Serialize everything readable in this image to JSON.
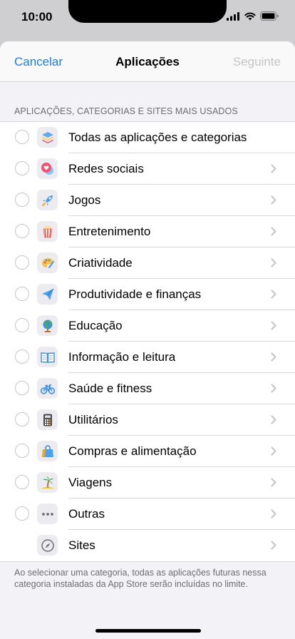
{
  "status_bar": {
    "time": "10:00"
  },
  "nav": {
    "cancel_label": "Cancelar",
    "title": "Aplicações",
    "next_label": "Seguinte"
  },
  "section_header": "APLICAÇÕES, CATEGORIAS E SITES MAIS USADOS",
  "categories": [
    {
      "label": "Todas as aplicações e categorias",
      "icon": "stack-icon"
    },
    {
      "label": "Redes sociais",
      "icon": "speech-bubble-heart-icon"
    },
    {
      "label": "Jogos",
      "icon": "rocket-icon"
    },
    {
      "label": "Entretenimento",
      "icon": "popcorn-icon"
    },
    {
      "label": "Criatividade",
      "icon": "palette-icon"
    },
    {
      "label": "Produtividade e finanças",
      "icon": "paper-plane-icon"
    },
    {
      "label": "Educação",
      "icon": "globe-icon"
    },
    {
      "label": "Informação e leitura",
      "icon": "book-icon"
    },
    {
      "label": "Saúde e fitness",
      "icon": "bicycle-icon"
    },
    {
      "label": "Utilitários",
      "icon": "calculator-icon"
    },
    {
      "label": "Compras e alimentação",
      "icon": "shopping-bag-icon"
    },
    {
      "label": "Viagens",
      "icon": "palm-tree-icon"
    },
    {
      "label": "Outras",
      "icon": "ellipsis-icon"
    },
    {
      "label": "Sites",
      "icon": "compass-icon"
    }
  ],
  "footer_note": "Ao selecionar uma categoria, todas as aplicações futuras nessa categoria instaladas da App Store serão incluídas no limite.",
  "colors": {
    "accent": "#1a7cf0",
    "disabled": "#c4c4c7"
  }
}
